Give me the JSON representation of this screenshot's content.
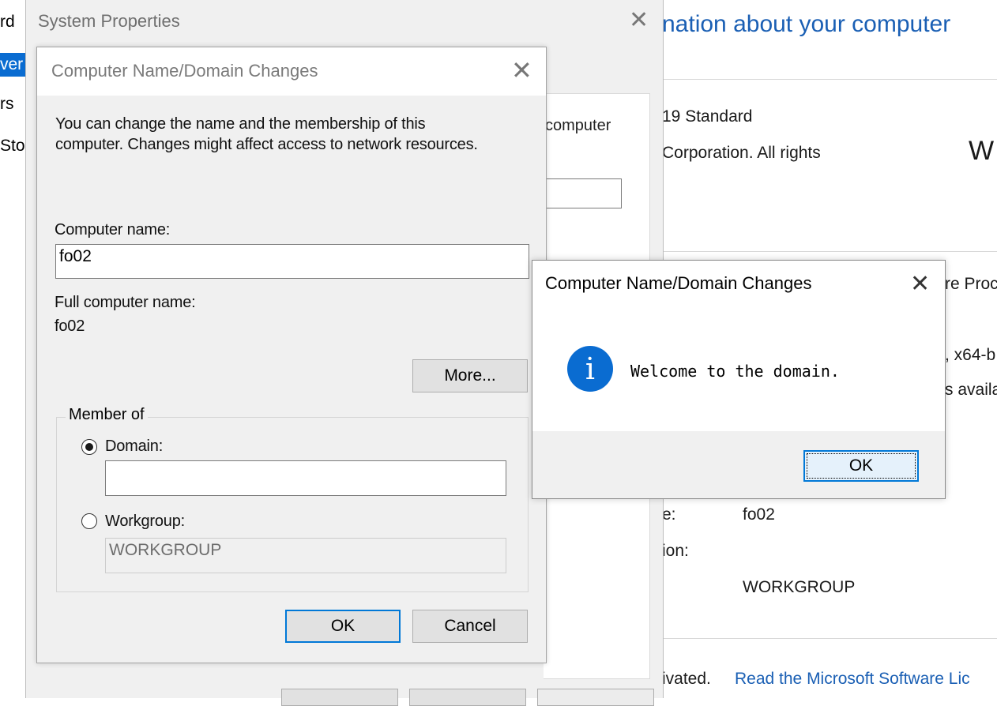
{
  "control_panel": {
    "left_items": [
      "rd",
      "ver",
      "rs",
      "Sto"
    ],
    "heading": "nation about your computer",
    "edition": "19 Standard",
    "copyright": "Corporation. All rights",
    "logo_partial": "W",
    "processor_label": "re Proc",
    "system_type": ", x64-b",
    "pen_touch": "s availa",
    "computer_name_label": "e:",
    "computer_name_value": "fo02",
    "domain_label": "ion:",
    "workgroup_value": "WORKGROUP",
    "activation_text": "ivated.",
    "license_link": "Read the Microsoft Software Lic"
  },
  "system_properties": {
    "title": "System Properties",
    "panel_text": "computer"
  },
  "cn_dialog": {
    "title": "Computer Name/Domain Changes",
    "description_line1": "You can change the name and the membership of this",
    "description_line2": "computer. Changes might affect access to network resources.",
    "computer_name_label": "Computer name:",
    "computer_name_value": "fo02",
    "full_name_label": "Full computer name:",
    "full_name_value": "fo02",
    "more_button": "More...",
    "member_of_label": "Member of",
    "domain_label": "Domain:",
    "domain_value": "",
    "workgroup_label": "Workgroup:",
    "workgroup_value": "WORKGROUP",
    "ok_button": "OK",
    "cancel_button": "Cancel"
  },
  "message_box": {
    "title": "Computer Name/Domain Changes",
    "message": "Welcome to the domain.",
    "ok_button": "OK",
    "icon": "info-icon"
  },
  "colors": {
    "accent": "#0078d7",
    "info_icon": "#0a6cd1",
    "link": "#1a5fb4"
  }
}
